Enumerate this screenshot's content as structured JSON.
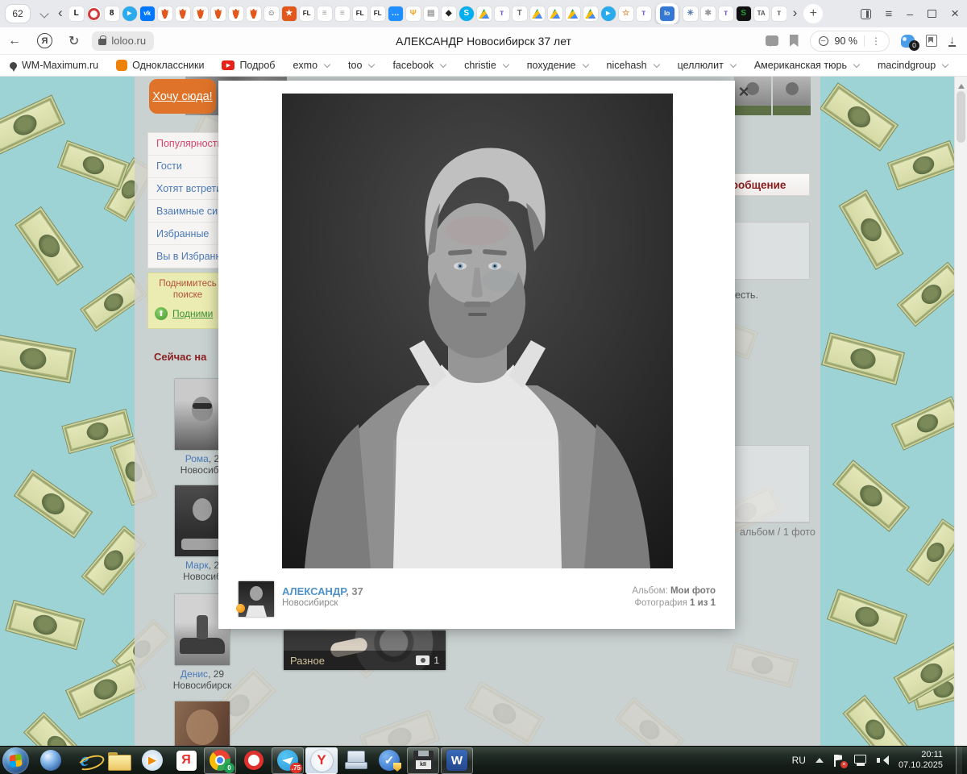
{
  "browser": {
    "tab_counter": "62",
    "back_tab_glyph": "‹",
    "overflow_tab_glyph": "›",
    "new_tab_glyph": "+",
    "menu_glyph": "≡",
    "minimize_glyph": "–",
    "close_glyph": "×",
    "tabs": [
      {
        "name": "l-serif",
        "shape": "letter",
        "glyph": "L",
        "bg": "#ffffff",
        "fg": "#111111"
      },
      {
        "name": "red-ring",
        "shape": "ring"
      },
      {
        "name": "eight",
        "shape": "letter",
        "glyph": "8",
        "bg": "#ffffff",
        "fg": "#111111"
      },
      {
        "name": "telegram",
        "shape": "circle",
        "glyph": "▸",
        "bg": "#2aabee",
        "fg": "#ffffff"
      },
      {
        "name": "vk",
        "shape": "letter",
        "glyph": "vk",
        "bg": "#0077ff",
        "fg": "#ffffff"
      },
      {
        "name": "flame",
        "shape": "flame"
      },
      {
        "name": "flame",
        "shape": "flame"
      },
      {
        "name": "flame",
        "shape": "flame"
      },
      {
        "name": "flame",
        "shape": "flame"
      },
      {
        "name": "flame",
        "shape": "flame"
      },
      {
        "name": "flame",
        "shape": "flame"
      },
      {
        "name": "smiley",
        "shape": "letter",
        "glyph": "☺",
        "bg": "#ffffff",
        "fg": "#333333"
      },
      {
        "name": "shield-star",
        "shape": "letter",
        "glyph": "★",
        "bg": "#e2571b",
        "fg": "#ffffff"
      },
      {
        "name": "fl",
        "shape": "letter",
        "glyph": "FL",
        "bg": "#ffffff",
        "fg": "#222222"
      },
      {
        "name": "fablic",
        "shape": "letter",
        "glyph": "≡",
        "bg": "#ffffff",
        "fg": "#999999"
      },
      {
        "name": "fablic",
        "shape": "letter",
        "glyph": "≡",
        "bg": "#ffffff",
        "fg": "#999999"
      },
      {
        "name": "fl",
        "shape": "letter",
        "glyph": "FL",
        "bg": "#ffffff",
        "fg": "#222222"
      },
      {
        "name": "fl",
        "shape": "letter",
        "glyph": "FL",
        "bg": "#ffffff",
        "fg": "#222222"
      },
      {
        "name": "chat",
        "shape": "letter",
        "glyph": "…",
        "bg": "#1f8fff",
        "fg": "#ffffff"
      },
      {
        "name": "hand",
        "shape": "letter",
        "glyph": "Ψ",
        "bg": "#ffffff",
        "fg": "#f5a623"
      },
      {
        "name": "doc",
        "shape": "letter",
        "glyph": "▤",
        "bg": "#ffffff",
        "fg": "#999999"
      },
      {
        "name": "jivo",
        "shape": "letter",
        "glyph": "◆",
        "bg": "#ffffff",
        "fg": "#222222"
      },
      {
        "name": "skype",
        "shape": "circle",
        "glyph": "S",
        "bg": "#00aff0",
        "fg": "#ffffff"
      },
      {
        "name": "drive",
        "shape": "triangle"
      },
      {
        "name": "t-purple",
        "shape": "letter",
        "glyph": "т",
        "bg": "#ffffff",
        "fg": "#7b5bd6"
      },
      {
        "name": "t-grey",
        "shape": "letter",
        "glyph": "T",
        "bg": "#ffffff",
        "fg": "#666666"
      },
      {
        "name": "drive",
        "shape": "triangle"
      },
      {
        "name": "drive",
        "shape": "triangle"
      },
      {
        "name": "drive",
        "shape": "triangle"
      },
      {
        "name": "drive",
        "shape": "triangle"
      },
      {
        "name": "telegram",
        "shape": "circle",
        "glyph": "▸",
        "bg": "#2aabee",
        "fg": "#ffffff"
      },
      {
        "name": "star",
        "shape": "letter",
        "glyph": "☆",
        "bg": "#ffffff",
        "fg": "#e2873b"
      },
      {
        "name": "t-purple",
        "shape": "letter",
        "glyph": "т",
        "bg": "#ffffff",
        "fg": "#7b5bd6"
      },
      {
        "name": "loloo",
        "shape": "letter",
        "glyph": "lo",
        "bg": "#3577d4",
        "fg": "#ffffff",
        "active": true
      },
      {
        "name": "swirl",
        "shape": "letter",
        "glyph": "✳",
        "bg": "#ffffff",
        "fg": "#5577aa"
      },
      {
        "name": "brain",
        "shape": "letter",
        "glyph": "✱",
        "bg": "#ffffff",
        "fg": "#9a9a9a"
      },
      {
        "name": "t-purple",
        "shape": "letter",
        "glyph": "т",
        "bg": "#ffffff",
        "fg": "#7b5bd6"
      },
      {
        "name": "sber",
        "shape": "letter",
        "glyph": "S",
        "bg": "#111111",
        "fg": "#21a038"
      },
      {
        "name": "ta",
        "shape": "letter",
        "glyph": "TA",
        "bg": "#ffffff",
        "fg": "#555555"
      },
      {
        "name": "t-grey",
        "shape": "letter",
        "glyph": "т",
        "bg": "#ffffff",
        "fg": "#666666"
      }
    ],
    "address": {
      "back_glyph": "←",
      "browser_letter": "Я",
      "reload_glyph": "↻",
      "domain": "loloo.ru",
      "title": "АЛЕКСАНДР Новосибирск 37 лет",
      "zoom_level": "90 %",
      "more_glyph": "⋮",
      "protect_badge": "0",
      "download_glyph": "↓"
    },
    "bookmarks": [
      {
        "label": "WM-Maximum.ru",
        "icon": "pin"
      },
      {
        "label": "Одноклассники",
        "icon": "ok"
      },
      {
        "label": "Подроб",
        "icon": "youtube"
      },
      {
        "label": "exmo",
        "folder": true
      },
      {
        "label": "too",
        "folder": true
      },
      {
        "label": "facebook",
        "folder": true
      },
      {
        "label": "christie",
        "folder": true
      },
      {
        "label": "похудение",
        "folder": true
      },
      {
        "label": "nicehash",
        "folder": true
      },
      {
        "label": "целлюлит",
        "folder": true
      },
      {
        "label": "Американская тюрь",
        "folder": true
      },
      {
        "label": "macindgroup",
        "folder": true
      }
    ],
    "bookmarks_overflow": "»"
  },
  "page": {
    "sidebar": {
      "cta": "Хочу сюда!",
      "menu": [
        {
          "label": "Популярность",
          "color": "#d6456f"
        },
        {
          "label": "Гости",
          "color": "#4a79b8"
        },
        {
          "label": "Хотят встретить",
          "color": "#4a79b8"
        },
        {
          "label": "Взаимные симп",
          "color": "#4a79b8"
        },
        {
          "label": "Избранные",
          "color": "#4a79b8"
        },
        {
          "label": "Вы в Избранны",
          "color": "#4a79b8"
        }
      ],
      "promo": {
        "line1": "Поднимитесь",
        "line2": "поиске",
        "arrow_glyph": "⬆",
        "link": "Подними"
      },
      "now_header": "Сейчас на",
      "users": [
        {
          "name": "Рома",
          "age": "2",
          "city": "Новосиби"
        },
        {
          "name": "Марк",
          "age": "2",
          "city": "Новосиб"
        },
        {
          "name": "Денис",
          "age": "29",
          "city": "Новосибирск"
        }
      ]
    },
    "right": {
      "message_header": "Сообщение",
      "text_fragment": "есть.",
      "album_fragment": "альбом / 1 фото"
    },
    "lightbox": {
      "close_glyph": "×",
      "name": "АЛЕКСАНДР",
      "age": ", 37",
      "city": "Новосибирск",
      "album_label": "Альбом: ",
      "album_value": "Мои фото",
      "photo_label": "Фотография ",
      "photo_value": "1 из 1"
    },
    "album_card": {
      "title": "Разное",
      "count": "1"
    }
  },
  "taskbar": {
    "apps": [
      {
        "name": "globe-app"
      },
      {
        "name": "internet-explorer",
        "glyph": "e"
      },
      {
        "name": "file-explorer"
      },
      {
        "name": "media-player",
        "glyph": "▶"
      },
      {
        "name": "yandex-app",
        "glyph": "Я"
      },
      {
        "name": "chrome",
        "open": true,
        "badge": "0",
        "badge_color": "#1f9d55"
      },
      {
        "name": "opera"
      },
      {
        "name": "telegram-app",
        "open": true,
        "badge": ".75",
        "badge_color": "#e03428"
      },
      {
        "name": "yandex-browser",
        "open": true,
        "active": true,
        "glyph": "Y"
      },
      {
        "name": "remote-desktop"
      },
      {
        "name": "security-app",
        "glyph": "✓"
      },
      {
        "name": "floppy-app",
        "open": true,
        "label": "kII"
      },
      {
        "name": "word",
        "open": true,
        "glyph": "W"
      }
    ],
    "tray": {
      "lang": "RU",
      "time": "20:11",
      "date": "07.10.2025"
    }
  }
}
